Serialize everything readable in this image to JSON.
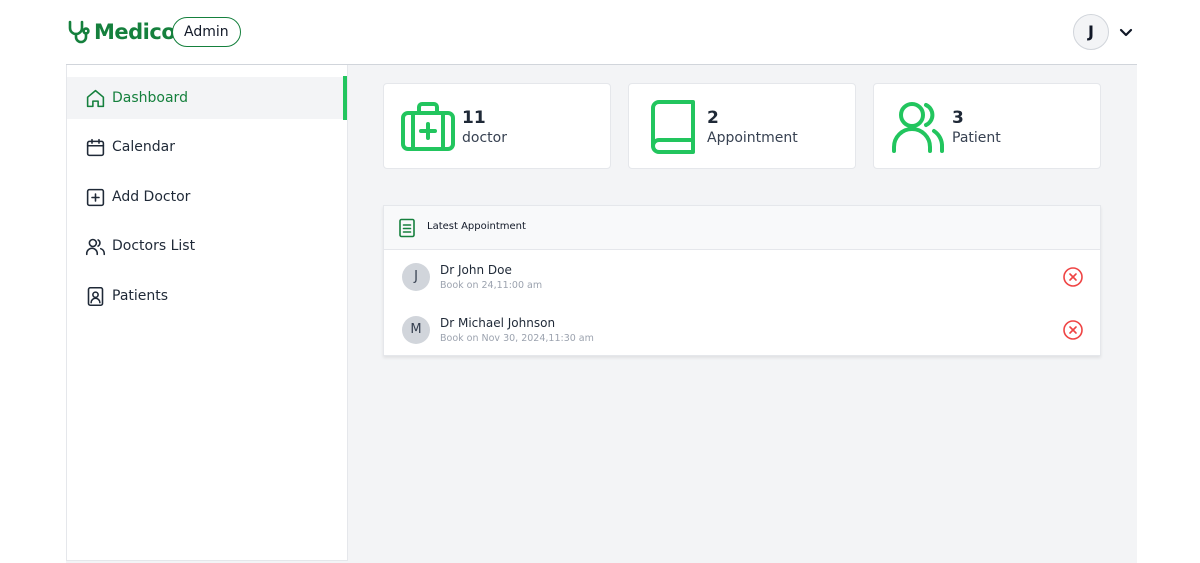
{
  "brand": {
    "name": "Medico",
    "accent": "#15803d",
    "accent_light": "#22c55e",
    "danger": "#ef4444"
  },
  "header": {
    "role": "Admin",
    "user_initial": "J"
  },
  "sidebar": {
    "items": [
      {
        "label": "Dashboard",
        "icon": "home-icon",
        "active": true
      },
      {
        "label": "Calendar",
        "icon": "calendar-icon"
      },
      {
        "label": "Add Doctor",
        "icon": "plus-square-icon"
      },
      {
        "label": "Doctors List",
        "icon": "users-icon"
      },
      {
        "label": "Patients",
        "icon": "contact-book-icon"
      }
    ]
  },
  "stats": [
    {
      "value": "11",
      "label": "doctor",
      "icon": "medical-kit-icon"
    },
    {
      "value": "2",
      "label": "Appointment",
      "icon": "book-icon"
    },
    {
      "value": "3",
      "label": "Patient",
      "icon": "users-icon"
    }
  ],
  "latest": {
    "title": "Latest Appointment",
    "icon": "document-icon",
    "items": [
      {
        "initial": "J",
        "name": "Dr John Doe",
        "time": "Book on 24,11:00 am"
      },
      {
        "initial": "M",
        "name": "Dr Michael Johnson",
        "time": "Book on Nov 30, 2024,11:30 am"
      }
    ]
  }
}
